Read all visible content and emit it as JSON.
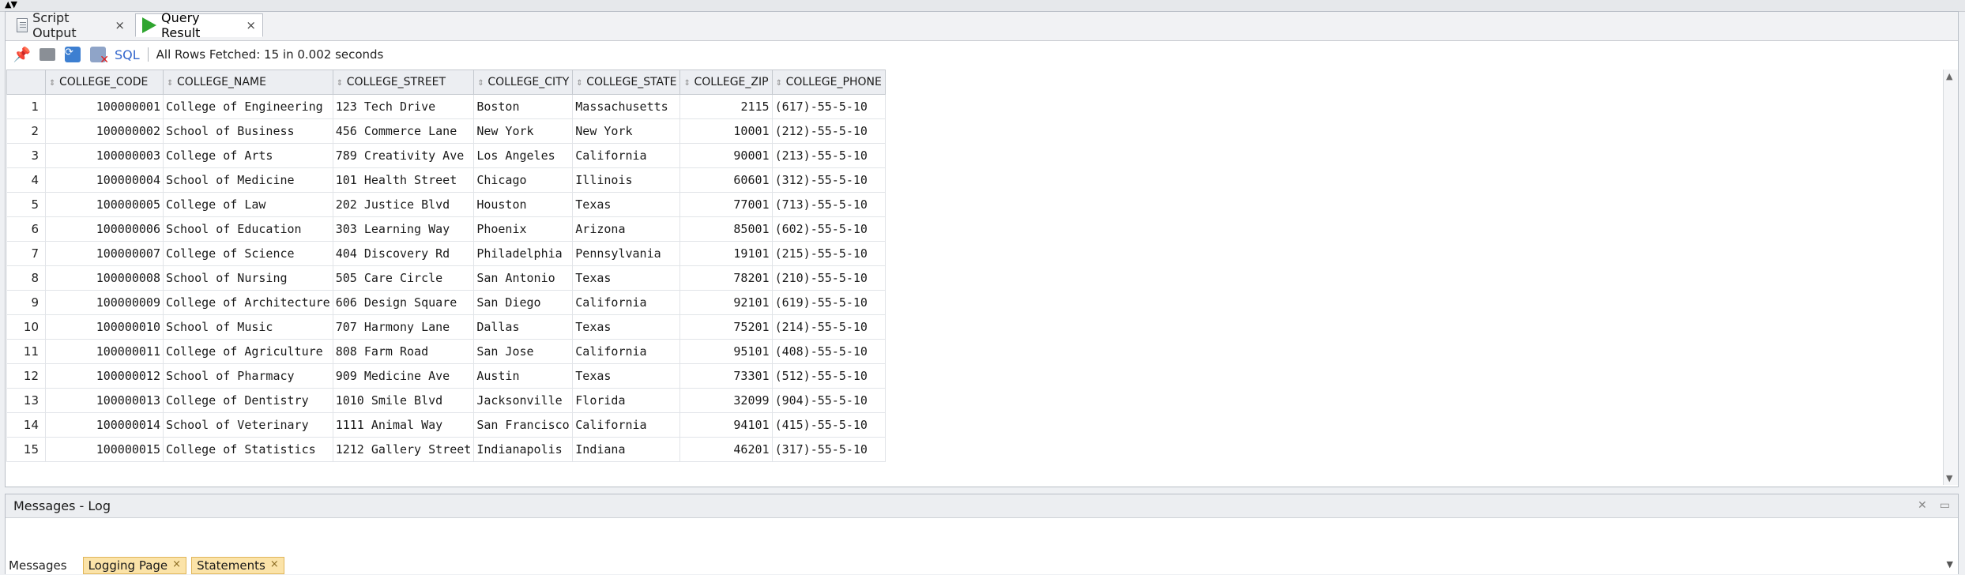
{
  "tabs": [
    {
      "label": "Script Output",
      "close": "×",
      "active": false
    },
    {
      "label": "Query Result",
      "close": "×",
      "active": true
    }
  ],
  "toolbar": {
    "sql_label": "SQL",
    "status": "All Rows Fetched: 15 in 0.002 seconds",
    "icons": [
      "pin-icon",
      "print-icon",
      "refresh-icon",
      "cancel-icon"
    ]
  },
  "grid": {
    "columns": [
      "COLLEGE_CODE",
      "COLLEGE_NAME",
      "COLLEGE_STREET",
      "COLLEGE_CITY",
      "COLLEGE_STATE",
      "COLLEGE_ZIP",
      "COLLEGE_PHONE"
    ],
    "rows": [
      [
        "1",
        "100000001",
        "College of Engineering",
        "123 Tech Drive",
        "Boston",
        "Massachusetts",
        "2115",
        "(617)-55-5-10"
      ],
      [
        "2",
        "100000002",
        "School of Business",
        "456 Commerce Lane",
        "New York",
        "New York",
        "10001",
        "(212)-55-5-10"
      ],
      [
        "3",
        "100000003",
        "College of Arts",
        "789 Creativity Ave",
        "Los Angeles",
        "California",
        "90001",
        "(213)-55-5-10"
      ],
      [
        "4",
        "100000004",
        "School of Medicine",
        "101 Health Street",
        "Chicago",
        "Illinois",
        "60601",
        "(312)-55-5-10"
      ],
      [
        "5",
        "100000005",
        "College of Law",
        "202 Justice Blvd",
        "Houston",
        "Texas",
        "77001",
        "(713)-55-5-10"
      ],
      [
        "6",
        "100000006",
        "School of Education",
        "303 Learning Way",
        "Phoenix",
        "Arizona",
        "85001",
        "(602)-55-5-10"
      ],
      [
        "7",
        "100000007",
        "College of Science",
        "404 Discovery Rd",
        "Philadelphia",
        "Pennsylvania",
        "19101",
        "(215)-55-5-10"
      ],
      [
        "8",
        "100000008",
        "School of Nursing",
        "505 Care Circle",
        "San Antonio",
        "Texas",
        "78201",
        "(210)-55-5-10"
      ],
      [
        "9",
        "100000009",
        "College of Architecture",
        "606 Design Square",
        "San Diego",
        "California",
        "92101",
        "(619)-55-5-10"
      ],
      [
        "10",
        "100000010",
        "School of Music",
        "707 Harmony Lane",
        "Dallas",
        "Texas",
        "75201",
        "(214)-55-5-10"
      ],
      [
        "11",
        "100000011",
        "College of Agriculture",
        "808 Farm Road",
        "San Jose",
        "California",
        "95101",
        "(408)-55-5-10"
      ],
      [
        "12",
        "100000012",
        "School of Pharmacy",
        "909 Medicine Ave",
        "Austin",
        "Texas",
        "73301",
        "(512)-55-5-10"
      ],
      [
        "13",
        "100000013",
        "College of Dentistry",
        "1010 Smile Blvd",
        "Jacksonville",
        "Florida",
        "32099",
        "(904)-55-5-10"
      ],
      [
        "14",
        "100000014",
        "School of Veterinary",
        "1111 Animal Way",
        "San Francisco",
        "California",
        "94101",
        "(415)-55-5-10"
      ],
      [
        "15",
        "100000015",
        "College of Statistics",
        "1212 Gallery Street",
        "Indianapolis",
        "Indiana",
        "46201",
        "(317)-55-5-10"
      ]
    ]
  },
  "messages": {
    "title": "Messages - Log",
    "label": "Messages",
    "tabs": [
      {
        "label": "Logging Page",
        "close": "×"
      },
      {
        "label": "Statements",
        "close": "×"
      }
    ]
  },
  "colors": {
    "accent": "#3366cc",
    "run": "#2fa52f",
    "tab_highlight": "#fbe3a8"
  }
}
